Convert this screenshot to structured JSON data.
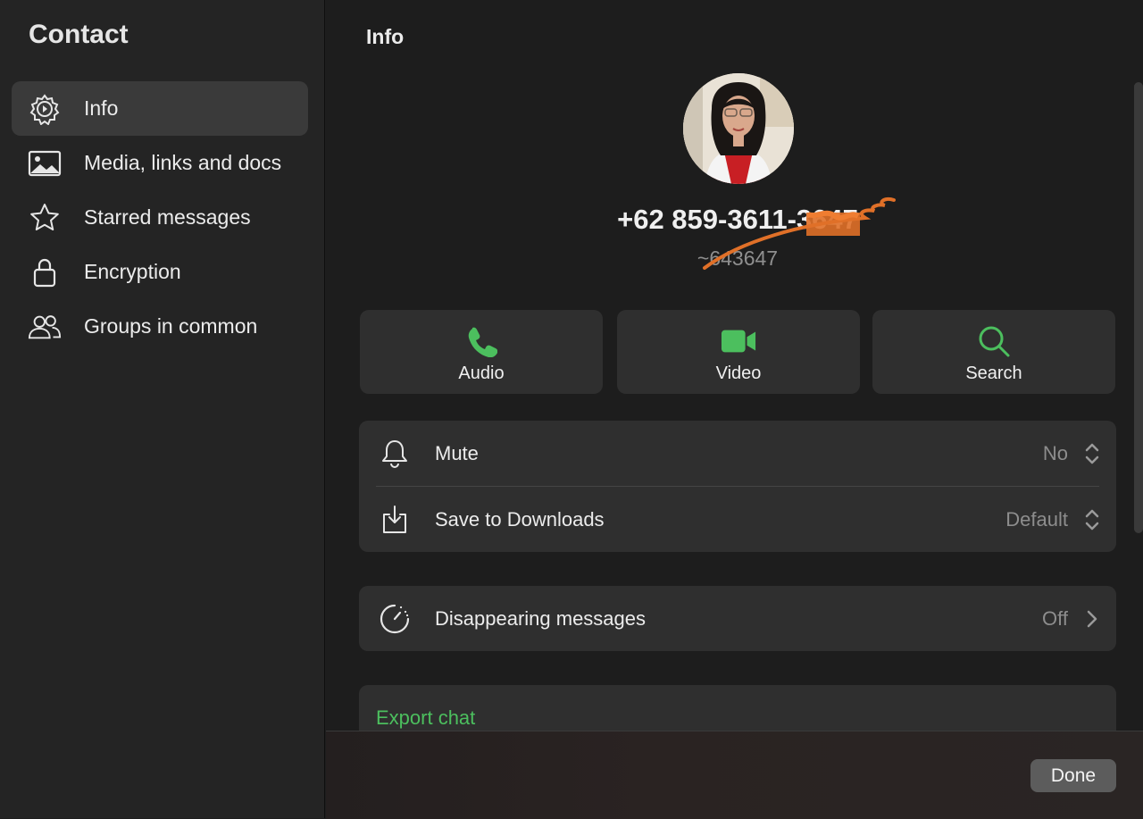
{
  "sidebar": {
    "title": "Contact",
    "items": [
      {
        "label": "Info",
        "icon": "info-gear-icon",
        "active": true
      },
      {
        "label": "Media, links and docs",
        "icon": "image-icon"
      },
      {
        "label": "Starred messages",
        "icon": "star-icon"
      },
      {
        "label": "Encryption",
        "icon": "lock-icon"
      },
      {
        "label": "Groups in common",
        "icon": "people-icon"
      }
    ]
  },
  "main": {
    "title": "Info",
    "contact": {
      "phone": "+62 859-3611-3647",
      "subname": "~643647"
    },
    "actions": [
      {
        "label": "Audio",
        "icon": "phone-icon",
        "color": "#4cbf5e"
      },
      {
        "label": "Video",
        "icon": "video-camera-icon",
        "color": "#4cbf5e"
      },
      {
        "label": "Search",
        "icon": "search-icon",
        "color": "#4cbf5e"
      }
    ],
    "settings": {
      "mute": {
        "label": "Mute",
        "value": "No"
      },
      "save_downloads": {
        "label": "Save to Downloads",
        "value": "Default"
      },
      "disappearing": {
        "label": "Disappearing messages",
        "value": "Off"
      }
    },
    "export": {
      "label": "Export chat",
      "color": "#4cbf5e"
    }
  },
  "footer": {
    "done_label": "Done"
  }
}
